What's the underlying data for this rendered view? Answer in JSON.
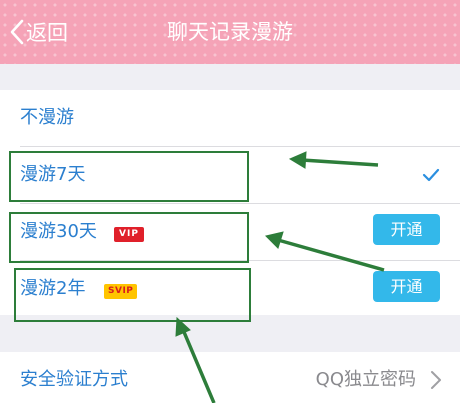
{
  "header": {
    "back_label": "返回",
    "title": "聊天记录漫游",
    "background_color": "#f5a3b7"
  },
  "options": [
    {
      "label": "不漫游",
      "selected": false
    },
    {
      "label": "漫游7天",
      "selected": true
    },
    {
      "label": "漫游30天",
      "badge": "VIP",
      "action_label": "开通"
    },
    {
      "label": "漫游2年",
      "badge": "SVIP",
      "action_label": "开通"
    }
  ],
  "security": {
    "label": "安全验证方式",
    "value": "QQ独立密码"
  },
  "icons": {
    "back": "chevron-left-icon",
    "check": "checkmark-icon",
    "forward": "chevron-right-icon"
  },
  "colors": {
    "link_text": "#2b7fcf",
    "button": "#33b8ea",
    "vip_badge": "#e0202a",
    "svip_badge": "#ffc400",
    "annotation": "#2d7d3a"
  }
}
